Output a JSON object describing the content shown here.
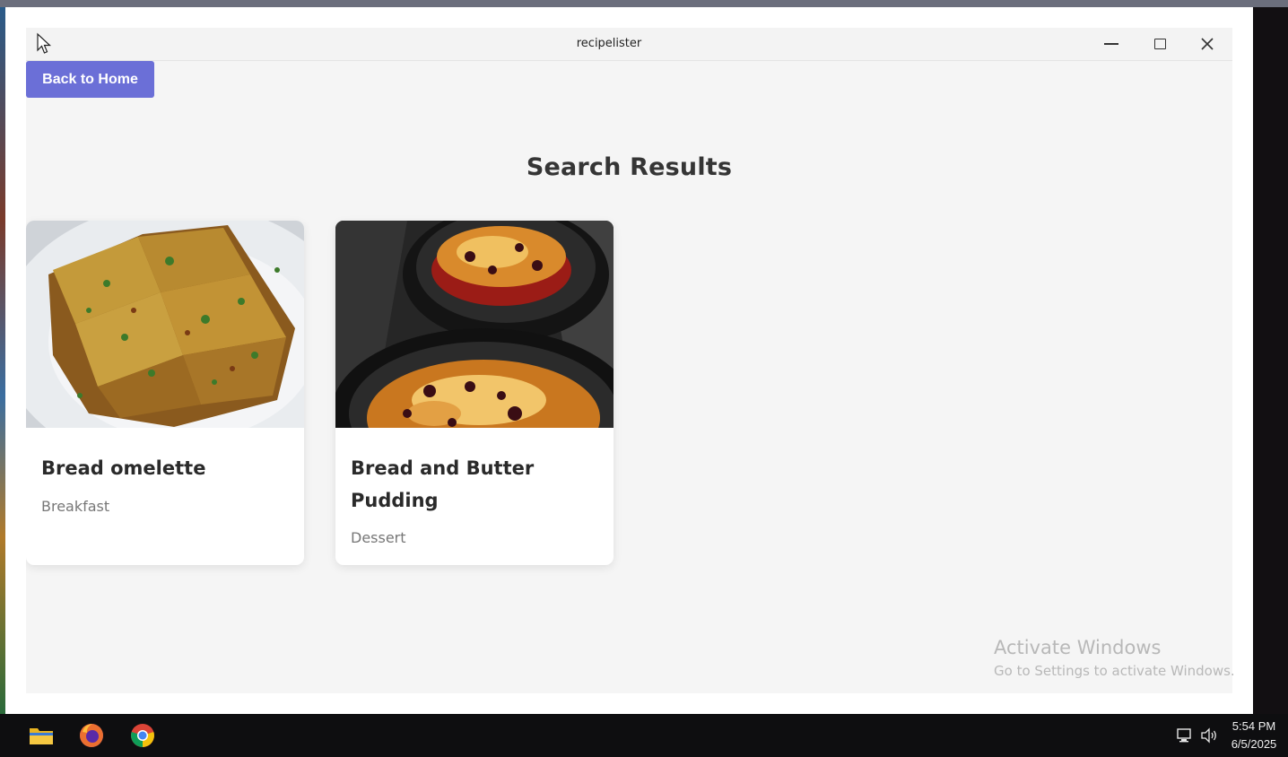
{
  "window": {
    "title": "recipelister"
  },
  "nav": {
    "back_label": "Back to Home"
  },
  "page": {
    "heading": "Search Results"
  },
  "results": [
    {
      "title": "Bread omelette",
      "category": "Breakfast",
      "image_icon": "bread-omelette-photo"
    },
    {
      "title": "Bread and Butter Pudding",
      "category": "Dessert",
      "image_icon": "bread-butter-pudding-photo"
    }
  ],
  "watermark": {
    "line1": "Activate Windows",
    "line2": "Go to Settings to activate Windows."
  },
  "taskbar": {
    "apps": [
      "file-explorer-icon",
      "firefox-icon",
      "chrome-icon"
    ],
    "time": "5:54 PM",
    "date": "6/5/2025"
  },
  "colors": {
    "accent": "#6b6fd7",
    "background": "#f5f5f5",
    "card": "#ffffff",
    "heading": "#353535"
  }
}
